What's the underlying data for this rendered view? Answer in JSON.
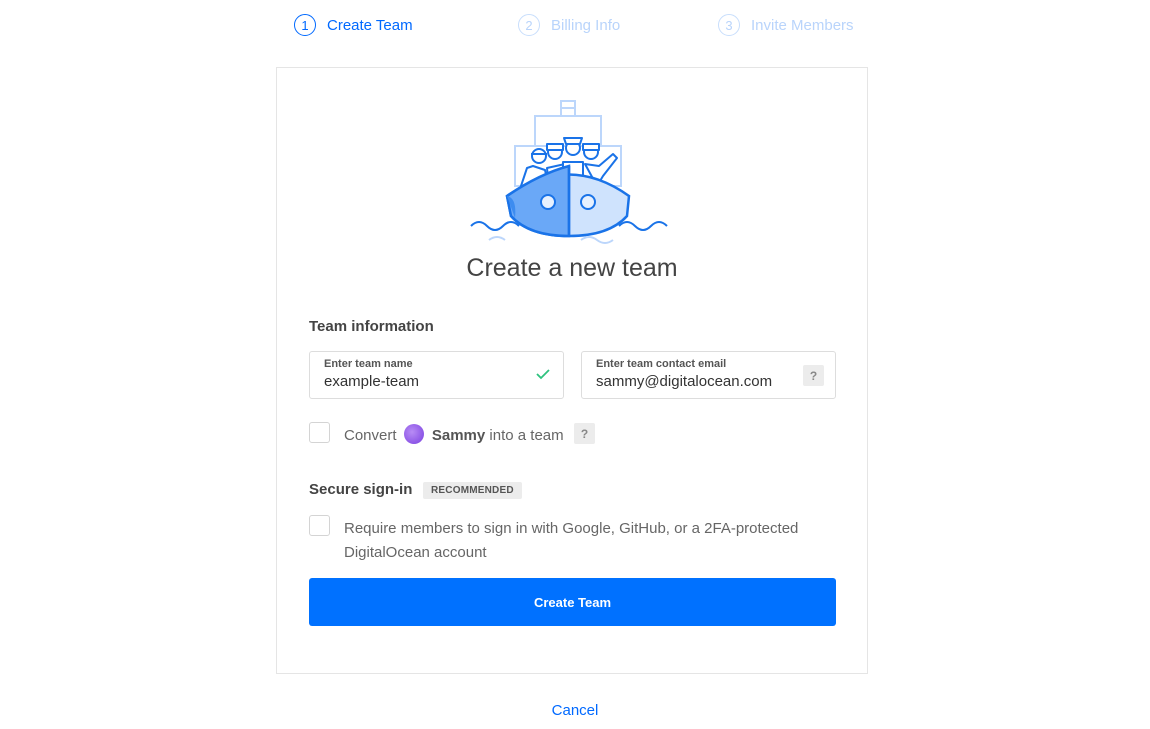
{
  "steps": [
    {
      "number": "1",
      "label": "Create Team",
      "state": "active"
    },
    {
      "number": "2",
      "label": "Billing Info",
      "state": "inactive"
    },
    {
      "number": "3",
      "label": "Invite Members",
      "state": "inactive"
    }
  ],
  "card": {
    "illustration": "ship-with-crew-illustration",
    "title": "Create a new team",
    "team_info": {
      "heading": "Team information",
      "team_name": {
        "label": "Enter team name",
        "value": "example-team",
        "status": "valid"
      },
      "team_email": {
        "label": "Enter team contact email",
        "value": "sammy@digitalocean.com",
        "help": "?"
      }
    },
    "convert": {
      "prefix": "Convert",
      "user": "Sammy",
      "suffix": "into a team",
      "help": "?",
      "checked": false
    },
    "secure": {
      "heading": "Secure sign-in",
      "badge": "RECOMMENDED",
      "line1": "Require members to sign in with Google, GitHub, or a 2FA-protected",
      "line2": "DigitalOcean account",
      "checked": false
    },
    "submit_label": "Create Team"
  },
  "cancel_label": "Cancel",
  "colors": {
    "primary": "#0071ff",
    "link": "#0069ff",
    "success": "#2ec27e"
  }
}
